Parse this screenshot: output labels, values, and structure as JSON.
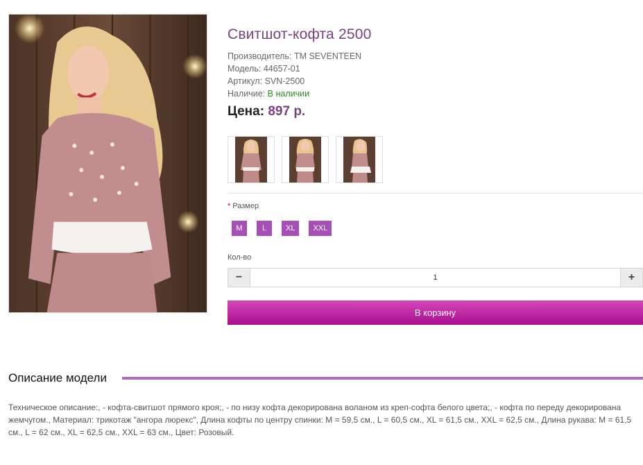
{
  "product": {
    "title": "Свитшот-кофта 2500",
    "manufacturer_label": "Производитель:",
    "manufacturer": "TM SEVENTEEN",
    "model_label": "Модель:",
    "model": "44657-01",
    "sku_label": "Артикул:",
    "sku": "SVN-2500",
    "availability_label": "Наличие:",
    "availability": "В наличии",
    "availability_color": "#2c8a1e",
    "price_label": "Цена:",
    "price": "897 р.",
    "accent_color": "#7b3f84"
  },
  "images": {
    "main": "product-photo-main",
    "thumbnails": [
      "product-thumb-1",
      "product-thumb-2",
      "product-thumb-3"
    ]
  },
  "options": {
    "required_mark": "*",
    "size_label": "Размер",
    "sizes": [
      "M",
      "L",
      "XL",
      "XXL"
    ],
    "size_button_color": "#a64fb6"
  },
  "quantity": {
    "label": "Кол-во",
    "value": "1",
    "minus_icon": "minus-icon",
    "plus_icon": "plus-icon"
  },
  "cart": {
    "button_label": "В корзину",
    "button_color": "#c02aa6"
  },
  "description": {
    "heading": "Описание модели",
    "line_color": "#b46ac2",
    "text": "Техническое описание:, - кофта-свитшот прямого кроя;, - по низу кофта декорирована воланом из креп-софта белого цвета;, - кофта по переду декорирована жемчугом., Материал: трикотаж \"ангора люрекс\", Длина кофты по центру спинки: M = 59,5 см., L = 60,5 см., XL = 61,5 см., XXL = 62,5 см., Длина рукава: M = 61,5 см., L = 62 см., XL = 62,5 см., XXL = 63 см., Цвет: Розовый."
  }
}
